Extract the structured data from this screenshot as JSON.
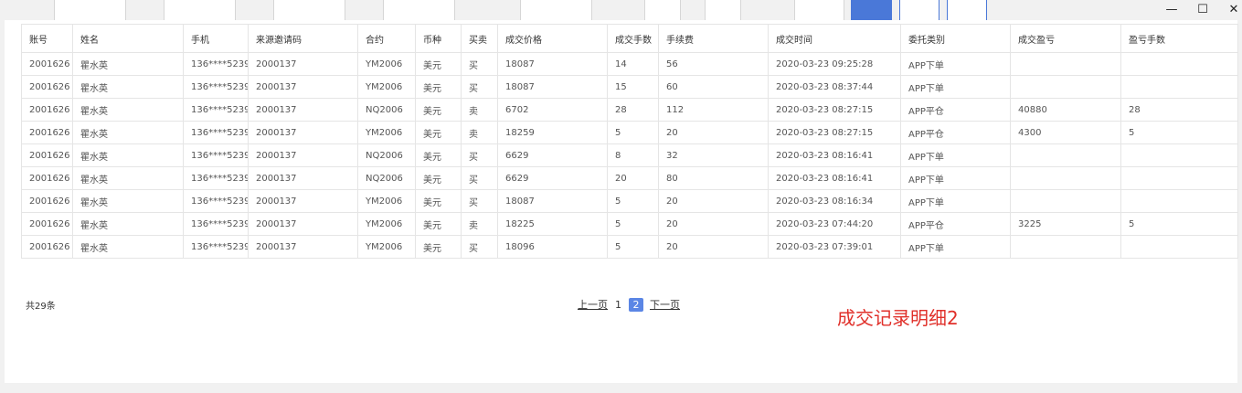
{
  "window": {
    "minimize_icon": "—",
    "maximize_icon": "☐",
    "close_icon": "✕"
  },
  "table": {
    "headers": [
      "账号",
      "姓名",
      "手机",
      "来源邀请码",
      "合约",
      "币种",
      "买卖",
      "成交价格",
      "成交手数",
      "手续费",
      "成交时间",
      "委托类别",
      "成交盈亏",
      "盈亏手数"
    ],
    "rows": [
      [
        "2001626",
        "瞿水英",
        "136****5239",
        "2000137",
        "YM2006",
        "美元",
        "买",
        "18087",
        "14",
        "56",
        "2020-03-23 09:25:28",
        "APP下单",
        "",
        ""
      ],
      [
        "2001626",
        "瞿水英",
        "136****5239",
        "2000137",
        "YM2006",
        "美元",
        "买",
        "18087",
        "15",
        "60",
        "2020-03-23 08:37:44",
        "APP下单",
        "",
        ""
      ],
      [
        "2001626",
        "瞿水英",
        "136****5239",
        "2000137",
        "NQ2006",
        "美元",
        "卖",
        "6702",
        "28",
        "112",
        "2020-03-23 08:27:15",
        "APP平仓",
        "40880",
        "28"
      ],
      [
        "2001626",
        "瞿水英",
        "136****5239",
        "2000137",
        "YM2006",
        "美元",
        "卖",
        "18259",
        "5",
        "20",
        "2020-03-23 08:27:15",
        "APP平仓",
        "4300",
        "5"
      ],
      [
        "2001626",
        "瞿水英",
        "136****5239",
        "2000137",
        "NQ2006",
        "美元",
        "买",
        "6629",
        "8",
        "32",
        "2020-03-23 08:16:41",
        "APP下单",
        "",
        ""
      ],
      [
        "2001626",
        "瞿水英",
        "136****5239",
        "2000137",
        "NQ2006",
        "美元",
        "买",
        "6629",
        "20",
        "80",
        "2020-03-23 08:16:41",
        "APP下单",
        "",
        ""
      ],
      [
        "2001626",
        "瞿水英",
        "136****5239",
        "2000137",
        "YM2006",
        "美元",
        "买",
        "18087",
        "5",
        "20",
        "2020-03-23 08:16:34",
        "APP下单",
        "",
        ""
      ],
      [
        "2001626",
        "瞿水英",
        "136****5239",
        "2000137",
        "YM2006",
        "美元",
        "卖",
        "18225",
        "5",
        "20",
        "2020-03-23 07:44:20",
        "APP平仓",
        "3225",
        "5"
      ],
      [
        "2001626",
        "瞿水英",
        "136****5239",
        "2000137",
        "YM2006",
        "美元",
        "买",
        "18096",
        "5",
        "20",
        "2020-03-23 07:39:01",
        "APP下单",
        "",
        ""
      ]
    ]
  },
  "footer": {
    "total": "共29条",
    "prev": "上一页",
    "page1": "1",
    "page2": "2",
    "next": "下一页"
  },
  "caption": "成交记录明细2",
  "colors": {
    "primary": "#4a78d8",
    "caption": "#e0302a"
  }
}
